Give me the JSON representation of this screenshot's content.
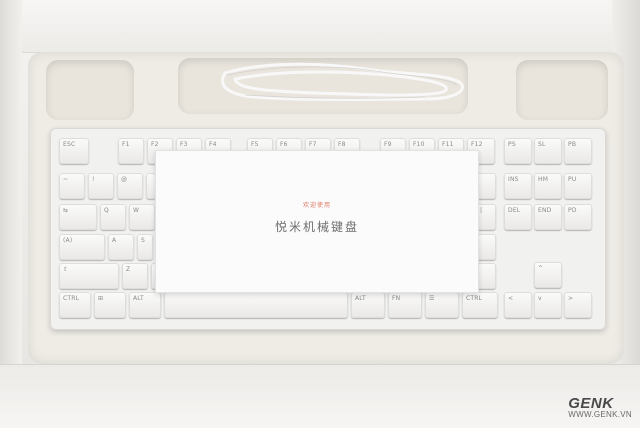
{
  "photo": {
    "subject": "keyboard-in-box",
    "colors": {
      "box": "#f2f1ee",
      "keycap": "#f6f6f5",
      "card_accent": "#e07a66"
    }
  },
  "card": {
    "small_text": "欢迎使用",
    "title": "悦米机械键盘"
  },
  "watermark": {
    "brand": "GENK",
    "url": "WWW.GENK.VN"
  },
  "keyboard": {
    "row1": [
      "ESC",
      "F1",
      "F2",
      "F3",
      "F4",
      "F5",
      "F6",
      "F7",
      "F8",
      "F9",
      "F10",
      "F11",
      "F12",
      "PS",
      "SL",
      "PB"
    ],
    "row2": [
      "INS",
      "HM",
      "PU"
    ],
    "row3": [
      "DEL",
      "END",
      "PD"
    ],
    "row5_left": [
      "(A)"
    ],
    "row6": [
      "CTRL",
      "⊞",
      "ALT",
      "ALT",
      "FN",
      "☰",
      "CTRL"
    ],
    "arrows": [
      "^",
      "<",
      "v",
      ">"
    ]
  }
}
